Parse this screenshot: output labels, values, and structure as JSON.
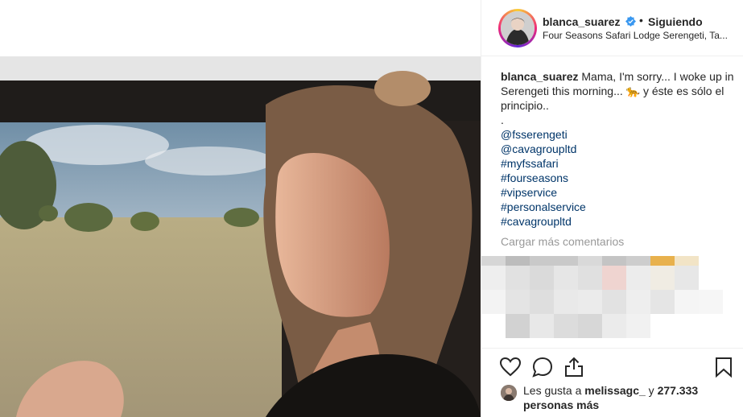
{
  "post": {
    "username": "blanca_suarez",
    "separator": "•",
    "follow_status": "Siguiendo",
    "location": "Four Seasons Safari Lodge Serengeti, Ta...",
    "caption": {
      "username": "blanca_suarez",
      "text": "Mama, I'm sorry... I woke up in Serengeti this morning... 🐆 y éste es sólo el principio..",
      "dot": "."
    },
    "tags": [
      "@fsserengeti",
      "@cavagroupltd",
      "#myfssafari",
      "#fourseasons",
      "#vipservice",
      "#personalservice",
      "#cavagroupltd"
    ],
    "load_more": "Cargar más comentarios",
    "likes": {
      "prefix": "Les gusta a",
      "user": "melissagc_",
      "joiner": "y",
      "count_text": "277.333 personas más"
    }
  },
  "colors": {
    "verified": "#3897f0",
    "link": "#003569",
    "muted": "#999999"
  },
  "icons": [
    "heart-icon",
    "comment-icon",
    "share-icon",
    "bookmark-icon",
    "verified-badge-icon"
  ]
}
